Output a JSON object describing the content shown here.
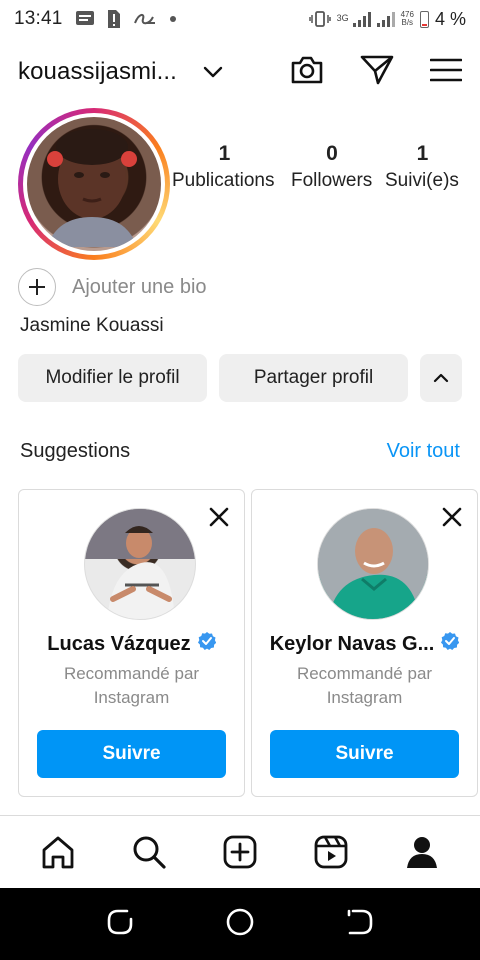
{
  "status_bar": {
    "time": "13:41",
    "net_type": "3G",
    "net_speed_value": "476",
    "net_speed_unit": "B/s",
    "battery": "4 %"
  },
  "header": {
    "username": "kouassijasmi..."
  },
  "profile": {
    "stats": [
      {
        "value": "1",
        "label": "Publications"
      },
      {
        "value": "0",
        "label": "Followers"
      },
      {
        "value": "1",
        "label": "Suivi(e)s"
      }
    ],
    "add_bio_label": "Ajouter une bio",
    "full_name": "Jasmine Kouassi",
    "edit_profile_label": "Modifier le profil",
    "share_profile_label": "Partager profil"
  },
  "suggestions": {
    "title": "Suggestions",
    "see_all_label": "Voir tout",
    "cards": [
      {
        "name": "Lucas Vázquez",
        "recommended_line1": "Recommandé par",
        "recommended_line2": "Instagram",
        "follow_label": "Suivre"
      },
      {
        "name": "Keylor Navas G...",
        "recommended_line1": "Recommandé par",
        "recommended_line2": "Instagram",
        "follow_label": "Suivre"
      }
    ]
  },
  "colors": {
    "accent_blue": "#0095f6",
    "link_blue": "#0a95f6",
    "verified_blue": "#3897f0"
  },
  "icons": {
    "header": [
      "chevron-down-icon",
      "camera-icon",
      "send-icon",
      "menu-icon"
    ],
    "tabbar": [
      "home-icon",
      "search-icon",
      "create-icon",
      "reels-icon",
      "profile-icon"
    ],
    "navbar": [
      "recents-icon",
      "home-circle-icon",
      "back-icon"
    ]
  }
}
